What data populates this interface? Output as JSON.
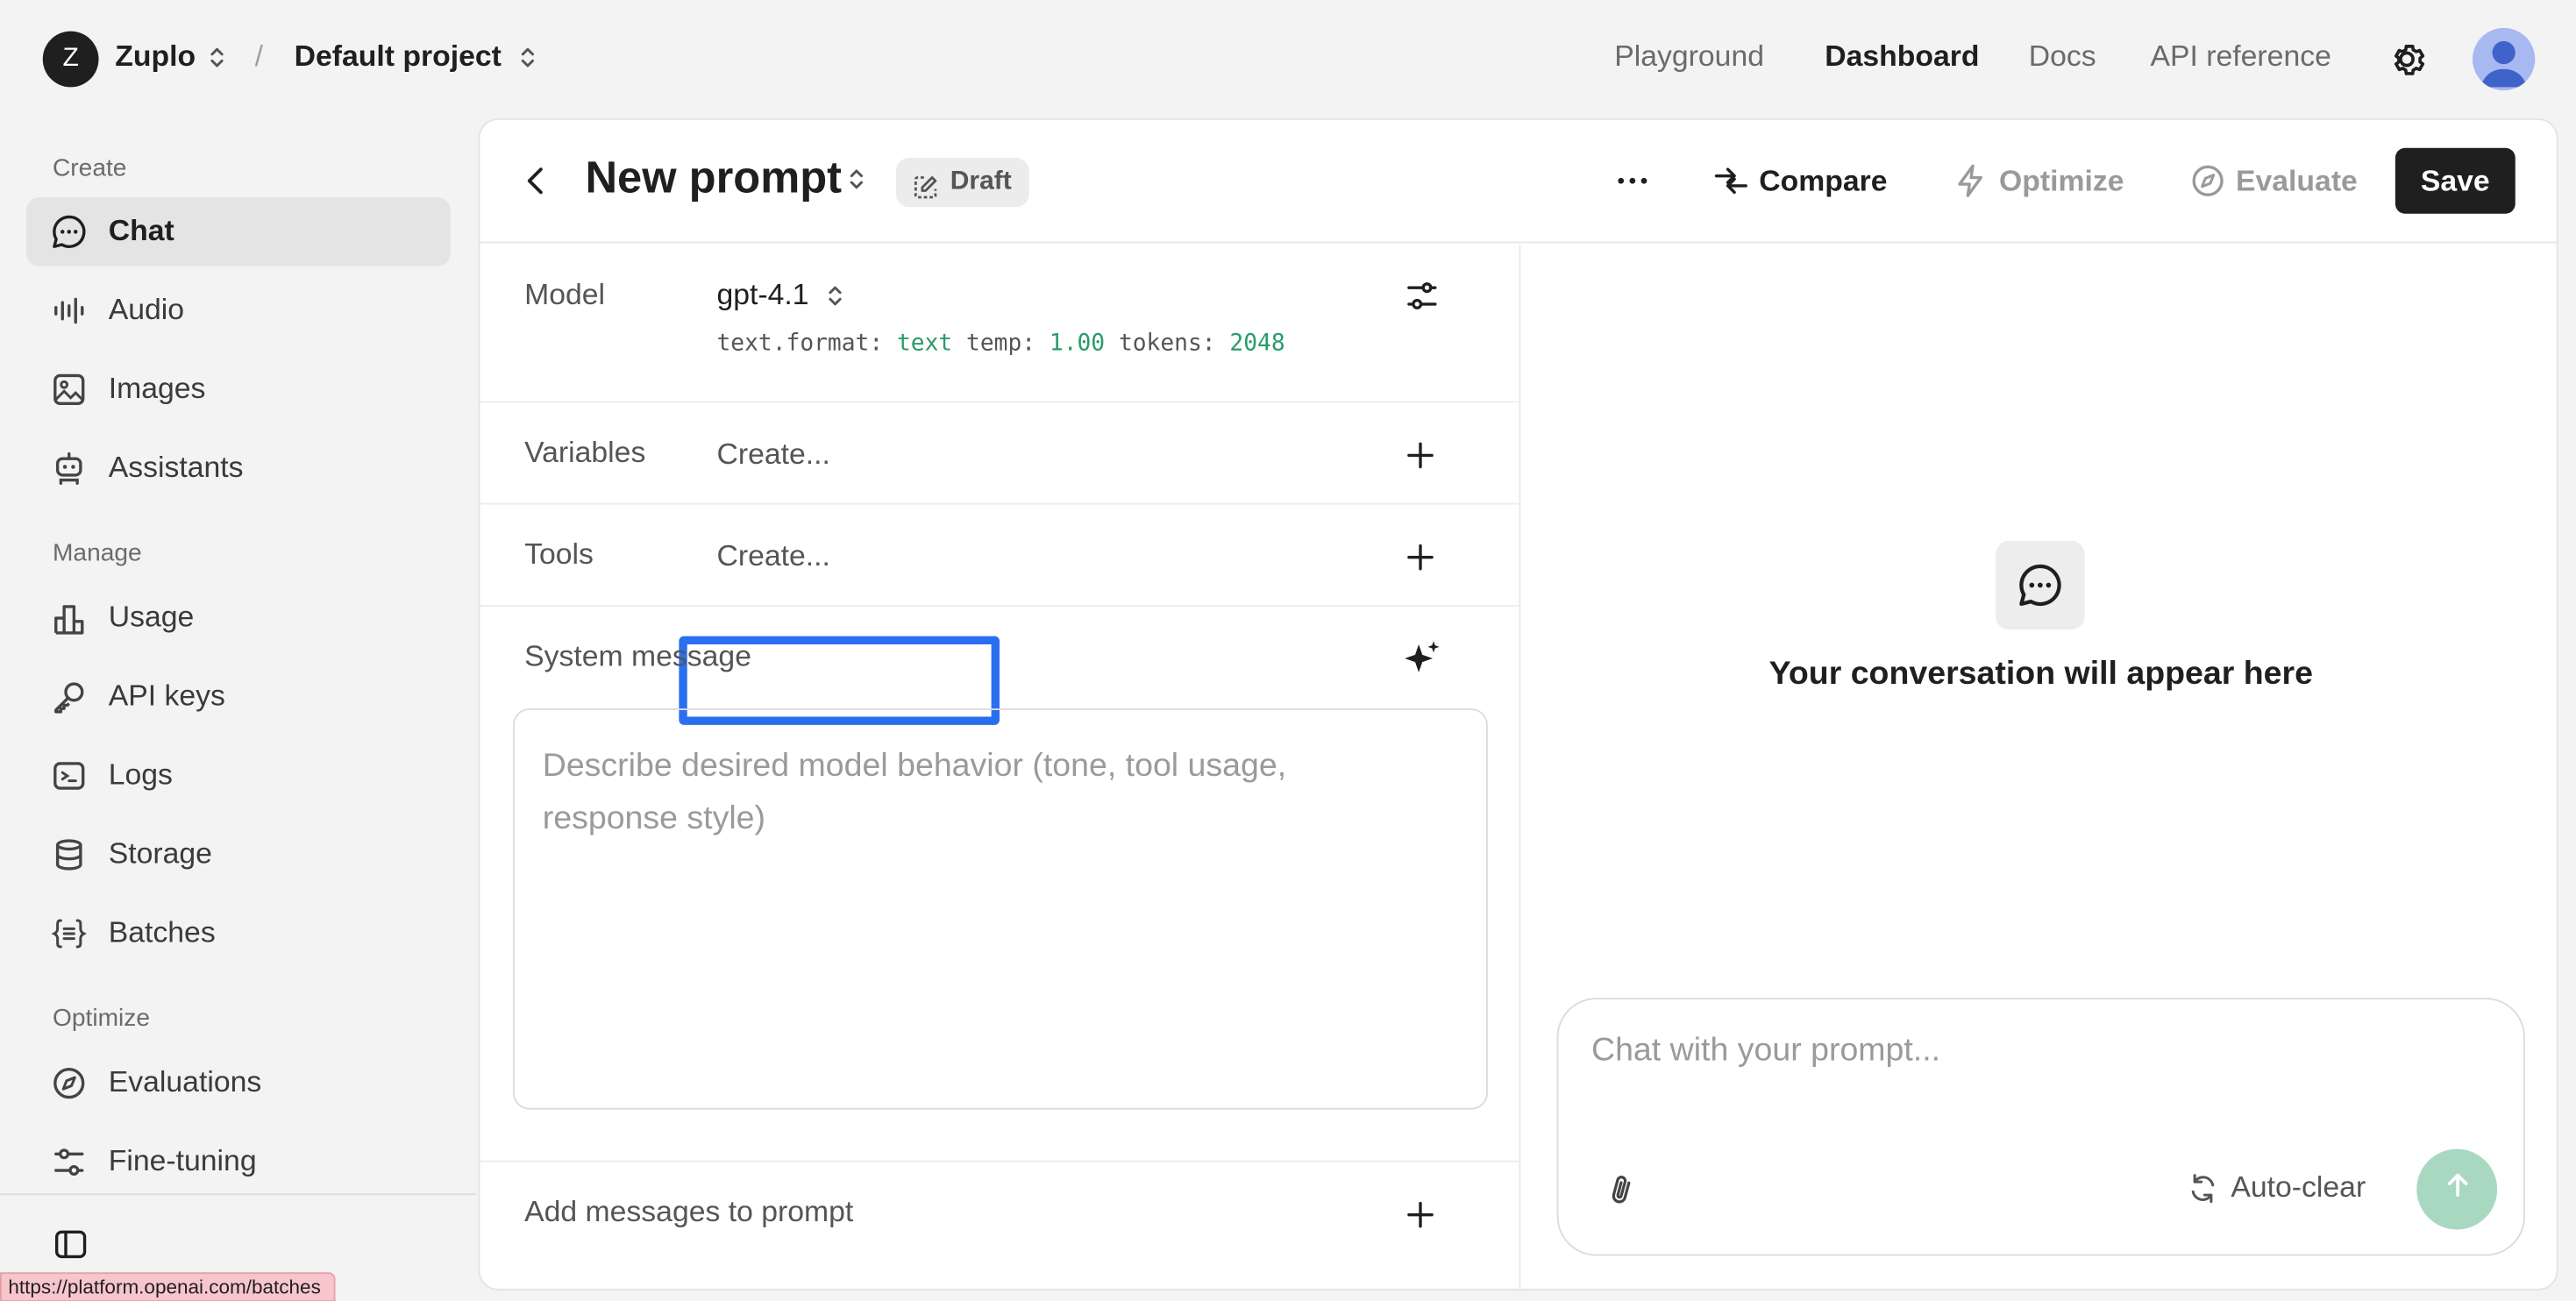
{
  "topbar": {
    "org_initial": "Z",
    "org_name": "Zuplo",
    "separator": "/",
    "project_name": "Default project",
    "nav": [
      "Playground",
      "Dashboard",
      "Docs",
      "API reference"
    ],
    "active_nav": "Dashboard"
  },
  "sidebar": {
    "sections": [
      {
        "label": "Create",
        "items": [
          {
            "label": "Chat",
            "icon": "chat-bubble-icon",
            "active": true
          },
          {
            "label": "Audio",
            "icon": "audio-wave-icon"
          },
          {
            "label": "Images",
            "icon": "image-icon"
          },
          {
            "label": "Assistants",
            "icon": "robot-icon"
          }
        ]
      },
      {
        "label": "Manage",
        "items": [
          {
            "label": "Usage",
            "icon": "bar-chart-icon"
          },
          {
            "label": "API keys",
            "icon": "key-icon"
          },
          {
            "label": "Logs",
            "icon": "terminal-icon"
          },
          {
            "label": "Storage",
            "icon": "database-icon"
          },
          {
            "label": "Batches",
            "icon": "braces-icon"
          }
        ]
      },
      {
        "label": "Optimize",
        "items": [
          {
            "label": "Evaluations",
            "icon": "compass-icon"
          },
          {
            "label": "Fine-tuning",
            "icon": "sliders-icon"
          }
        ]
      }
    ],
    "status_url": "https://platform.openai.com/batches"
  },
  "header": {
    "title": "New prompt",
    "badge": "Draft",
    "compare": "Compare",
    "optimize": "Optimize",
    "evaluate": "Evaluate",
    "save": "Save"
  },
  "config": {
    "model_label": "Model",
    "model_value": "gpt-4.1",
    "meta": {
      "format_key": "text.format:",
      "format_val": "text",
      "temp_key": "temp:",
      "temp_val": "1.00",
      "tokens_key": "tokens:",
      "tokens_val": "2048"
    },
    "variables_label": "Variables",
    "variables_create": "Create...",
    "tools_label": "Tools",
    "tools_create": "Create...",
    "system_label": "System message",
    "system_placeholder": "Describe desired model behavior (tone, tool usage, response style)",
    "add_messages": "Add messages to prompt"
  },
  "chat": {
    "empty_text": "Your conversation will appear here",
    "input_placeholder": "Chat with your prompt...",
    "auto_clear": "Auto-clear"
  },
  "colors": {
    "accent_focus": "#2a6ff0",
    "meta_green": "#2a9b6b",
    "send_disabled": "#a8d8c0"
  }
}
